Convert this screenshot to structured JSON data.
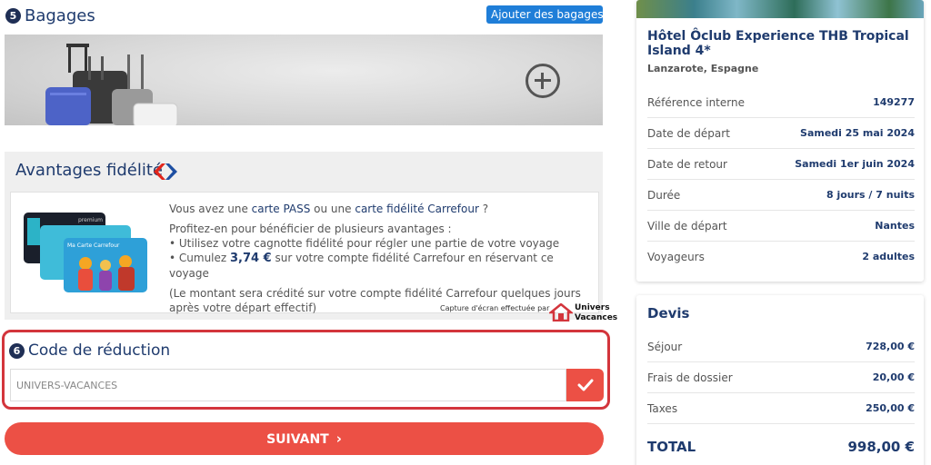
{
  "bagages": {
    "step": "5",
    "title": "Bagages",
    "add_button": "Ajouter des bagages"
  },
  "fidelite": {
    "title": "Avantages fidélité",
    "line1_pre": "Vous avez une ",
    "line1_link1": "carte PASS",
    "line1_mid": " ou une ",
    "line1_link2": "carte fidélité Carrefour",
    "line1_post": " ?",
    "line2": "Profitez-en pour bénéficier de plusieurs avantages :",
    "bullet1": "• Utilisez votre cagnotte fidélité pour régler une partie de votre voyage",
    "bullet2_pre": "• Cumulez ",
    "bullet2_amount": "3,74 €",
    "bullet2_post": " sur votre compte fidélité Carrefour en réservant ce voyage",
    "note": "(Le montant sera crédité sur votre compte fidélité Carrefour quelques jours après votre départ effectif)",
    "card_label": "Ma Carte Carrefour",
    "card_premium": "premium"
  },
  "watermark": {
    "capture": "Capture d'écran effectuée par",
    "brand1": "Univers",
    "brand2": "Vacances"
  },
  "reduction": {
    "step": "6",
    "title": "Code de réduction",
    "code_value": "UNIVERS-VACANCES"
  },
  "next_button": "SUIVANT",
  "hotel": {
    "name": "Hôtel Ôclub Experience THB Tropical Island 4*",
    "location": "Lanzarote, Espagne",
    "rows": [
      {
        "label": "Référence interne",
        "value": "149277"
      },
      {
        "label": "Date de départ",
        "value": "Samedi 25 mai 2024"
      },
      {
        "label": "Date de retour",
        "value": "Samedi 1er juin 2024"
      },
      {
        "label": "Durée",
        "value": "8 jours / 7 nuits"
      },
      {
        "label": "Ville de départ",
        "value": "Nantes"
      },
      {
        "label": "Voyageurs",
        "value": "2 adultes"
      }
    ]
  },
  "devis": {
    "title": "Devis",
    "rows": [
      {
        "label": "Séjour",
        "value": "728,00 €"
      },
      {
        "label": "Frais de dossier",
        "value": "20,00 €"
      },
      {
        "label": "Taxes",
        "value": "250,00 €"
      }
    ],
    "total_label": "TOTAL",
    "total_value": "998,00 €"
  },
  "colors": {
    "navy": "#1f3b6e",
    "blue_button": "#1f7ed8",
    "accent_red": "#ec5045",
    "highlight_border": "#d3353c"
  },
  "icons": [
    "plus-circle-icon",
    "carrefour-logo-icon",
    "checkmark-icon",
    "chevron-right-icon",
    "univers-vacances-logo-icon"
  ]
}
